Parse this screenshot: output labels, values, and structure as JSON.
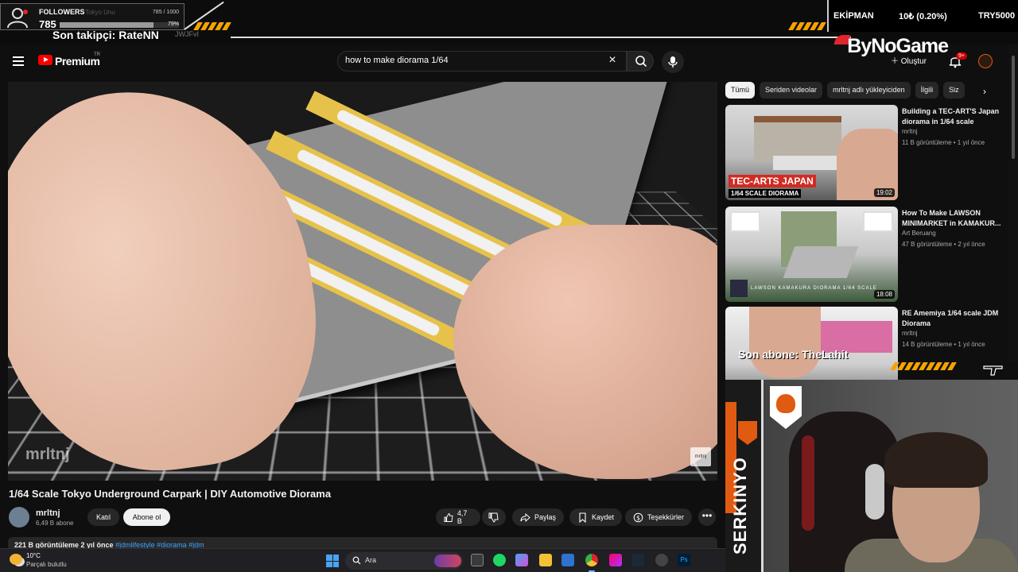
{
  "overlay": {
    "followers_title": "FOLLOWERS",
    "followers_source": "Tokyo Unu",
    "followers_count": "785",
    "followers_goal": "785 / 1000",
    "followers_percent": "79%",
    "followers_progress": 0.785,
    "last_follower": "Son takipçi: RateNN",
    "url_fragment": "JWJFvI",
    "stock_name": "EKİPMAN",
    "stock_change": "10₺ (0.20%)",
    "stock_price": "TRY5000",
    "sponsor": "ByNoGame",
    "last_subscriber": "Son abone: TheLahit",
    "streamer_name": "SERKINYO"
  },
  "header": {
    "brand": "Premium",
    "region": "TR",
    "search_value": "how to make diorama 1/64",
    "create_label": "Oluştur",
    "notification_count": "9+"
  },
  "video": {
    "watermark": "mrltnj",
    "title": "1/64 Scale Tokyo Underground Carpark | DIY Automotive Diorama",
    "channel": "mrltnj",
    "subscribers": "6,49 B abone",
    "join_label": "Katıl",
    "subscribe_label": "Abone ol",
    "likes": "4,7 B",
    "share_label": "Paylaş",
    "save_label": "Kaydet",
    "thanks_label": "Teşekkürler",
    "more_label": "•••",
    "stats": "221 B görüntüleme  2 yıl önce",
    "hashtags": "#jdmlifestyle #diorama #jdm"
  },
  "sidebar": {
    "chips": [
      "Tümü",
      "Seriden videolar",
      "mrltnj adlı yükleyiciden",
      "İlgili",
      "Siz"
    ],
    "recommendations": [
      {
        "title": "Building a TEC-ART'S Japan diorama in 1/64 scale",
        "channel": "mrltnj",
        "meta": "11 B görüntüleme • 1 yıl önce",
        "duration": "19:02",
        "thumb_text": "TEC-ARTS JAPAN",
        "thumb_sub": "1/64 SCALE DIORAMA"
      },
      {
        "title": "How To Make LAWSON MINIMARKET in KAMAKUR...",
        "channel": "Art Beruang",
        "meta": "47 B görüntüleme • 2 yıl önce",
        "duration": "18:08",
        "thumb_text": "LAWSON KAMAKURA DIORAMA 1/64 SCALE",
        "thumb_sub": ""
      },
      {
        "title": "RE Amemiya 1/64 scale JDM Diorama",
        "channel": "mrltnj",
        "meta": "14 B görüntüleme • 1 yıl önce",
        "duration": "",
        "thumb_text": "",
        "thumb_sub": ""
      }
    ]
  },
  "taskbar": {
    "temperature": "10°C",
    "weather": "Parçalı bulutlu",
    "search_label": "Ara"
  },
  "colors": {
    "accent_orange": "#e05a12",
    "youtube_red": "#ff0000",
    "stripe_yellow": "#f5a300",
    "tape_yellow": "#e7c24a",
    "sponsor_red": "#e0252d"
  }
}
